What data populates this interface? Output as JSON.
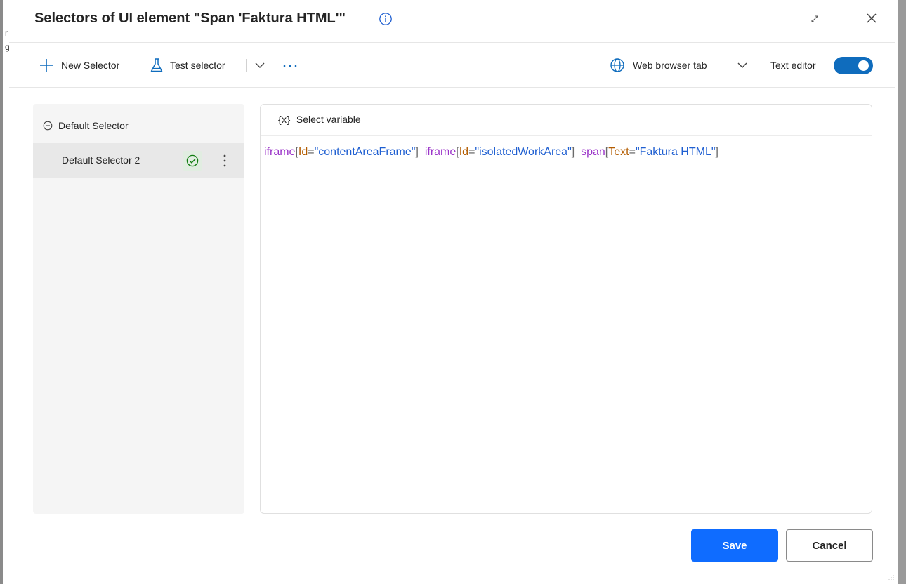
{
  "window": {
    "background_fragments": [
      "r",
      "g"
    ]
  },
  "dialog": {
    "title": "Selectors of UI element \"Span 'Faktura HTML'\""
  },
  "toolbar": {
    "new_selector_label": "New Selector",
    "test_selector_label": "Test selector",
    "context_label": "Web browser tab",
    "text_editor_label": "Text editor",
    "text_editor_on": true,
    "accent_color": "#0f6cbd"
  },
  "selector_tree": {
    "group_label": "Default Selector",
    "items": [
      {
        "label": "Default Selector 2",
        "status": "valid"
      }
    ]
  },
  "editor": {
    "variable_button_icon": "{x}",
    "variable_button_label": "Select variable",
    "tokens": [
      {
        "t": "iframe",
        "k": "tag"
      },
      {
        "t": "[",
        "k": "br"
      },
      {
        "t": "Id",
        "k": "attr"
      },
      {
        "t": "=",
        "k": "eq"
      },
      {
        "t": "\"contentAreaFrame\"",
        "k": "val"
      },
      {
        "t": "]",
        "k": "br"
      },
      {
        "t": "  ",
        "k": "sp"
      },
      {
        "t": "iframe",
        "k": "tag"
      },
      {
        "t": "[",
        "k": "br"
      },
      {
        "t": "Id",
        "k": "attr"
      },
      {
        "t": "=",
        "k": "eq"
      },
      {
        "t": "\"isolatedWorkArea\"",
        "k": "val"
      },
      {
        "t": "]",
        "k": "br"
      },
      {
        "t": "  ",
        "k": "sp"
      },
      {
        "t": "span",
        "k": "tag"
      },
      {
        "t": "[",
        "k": "br"
      },
      {
        "t": "Text",
        "k": "attr"
      },
      {
        "t": "=",
        "k": "eq"
      },
      {
        "t": "\"Faktura HTML\"",
        "k": "val"
      },
      {
        "t": "]",
        "k": "br"
      }
    ]
  },
  "footer": {
    "save_label": "Save",
    "cancel_label": "Cancel",
    "save_color": "#0f6cff"
  }
}
